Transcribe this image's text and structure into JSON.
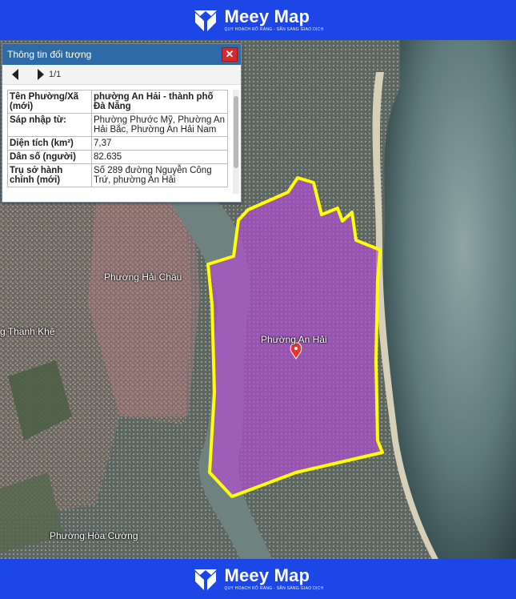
{
  "brand": {
    "name": "Meey Map",
    "tagline": "QUY HOẠCH RÕ RÀNG - SẴN SÀNG GIAO DỊCH",
    "color": "#1c46e6"
  },
  "popup": {
    "title": "Thông tin đối tượng",
    "pager": "1/1",
    "rows": [
      {
        "key": "Tên Phường/Xã (mới)",
        "value": "phường An Hải - thành phố Đà Nẵng"
      },
      {
        "key": "Sáp nhập từ:",
        "value": "Phường Phước Mỹ, Phường An Hải Bắc, Phường An Hải Nam"
      },
      {
        "key": "Diện tích (km²)",
        "value": "7,37"
      },
      {
        "key": "Dân số (người)",
        "value": "82.635"
      },
      {
        "key": "Trụ sở hành chính (mới)",
        "value": "Số 289 đường Nguyễn Công Trứ, phường An Hải"
      }
    ]
  },
  "map": {
    "labels": {
      "hai_chau": "Phường Hải Châu",
      "thanh_khe": "g Thanh Khê",
      "an_hai": "Phường An Hải",
      "hoa_cuong": "Phường Hòa Cường"
    },
    "highlight_color": "#ffff00",
    "fill_color": "#b04fd0"
  }
}
